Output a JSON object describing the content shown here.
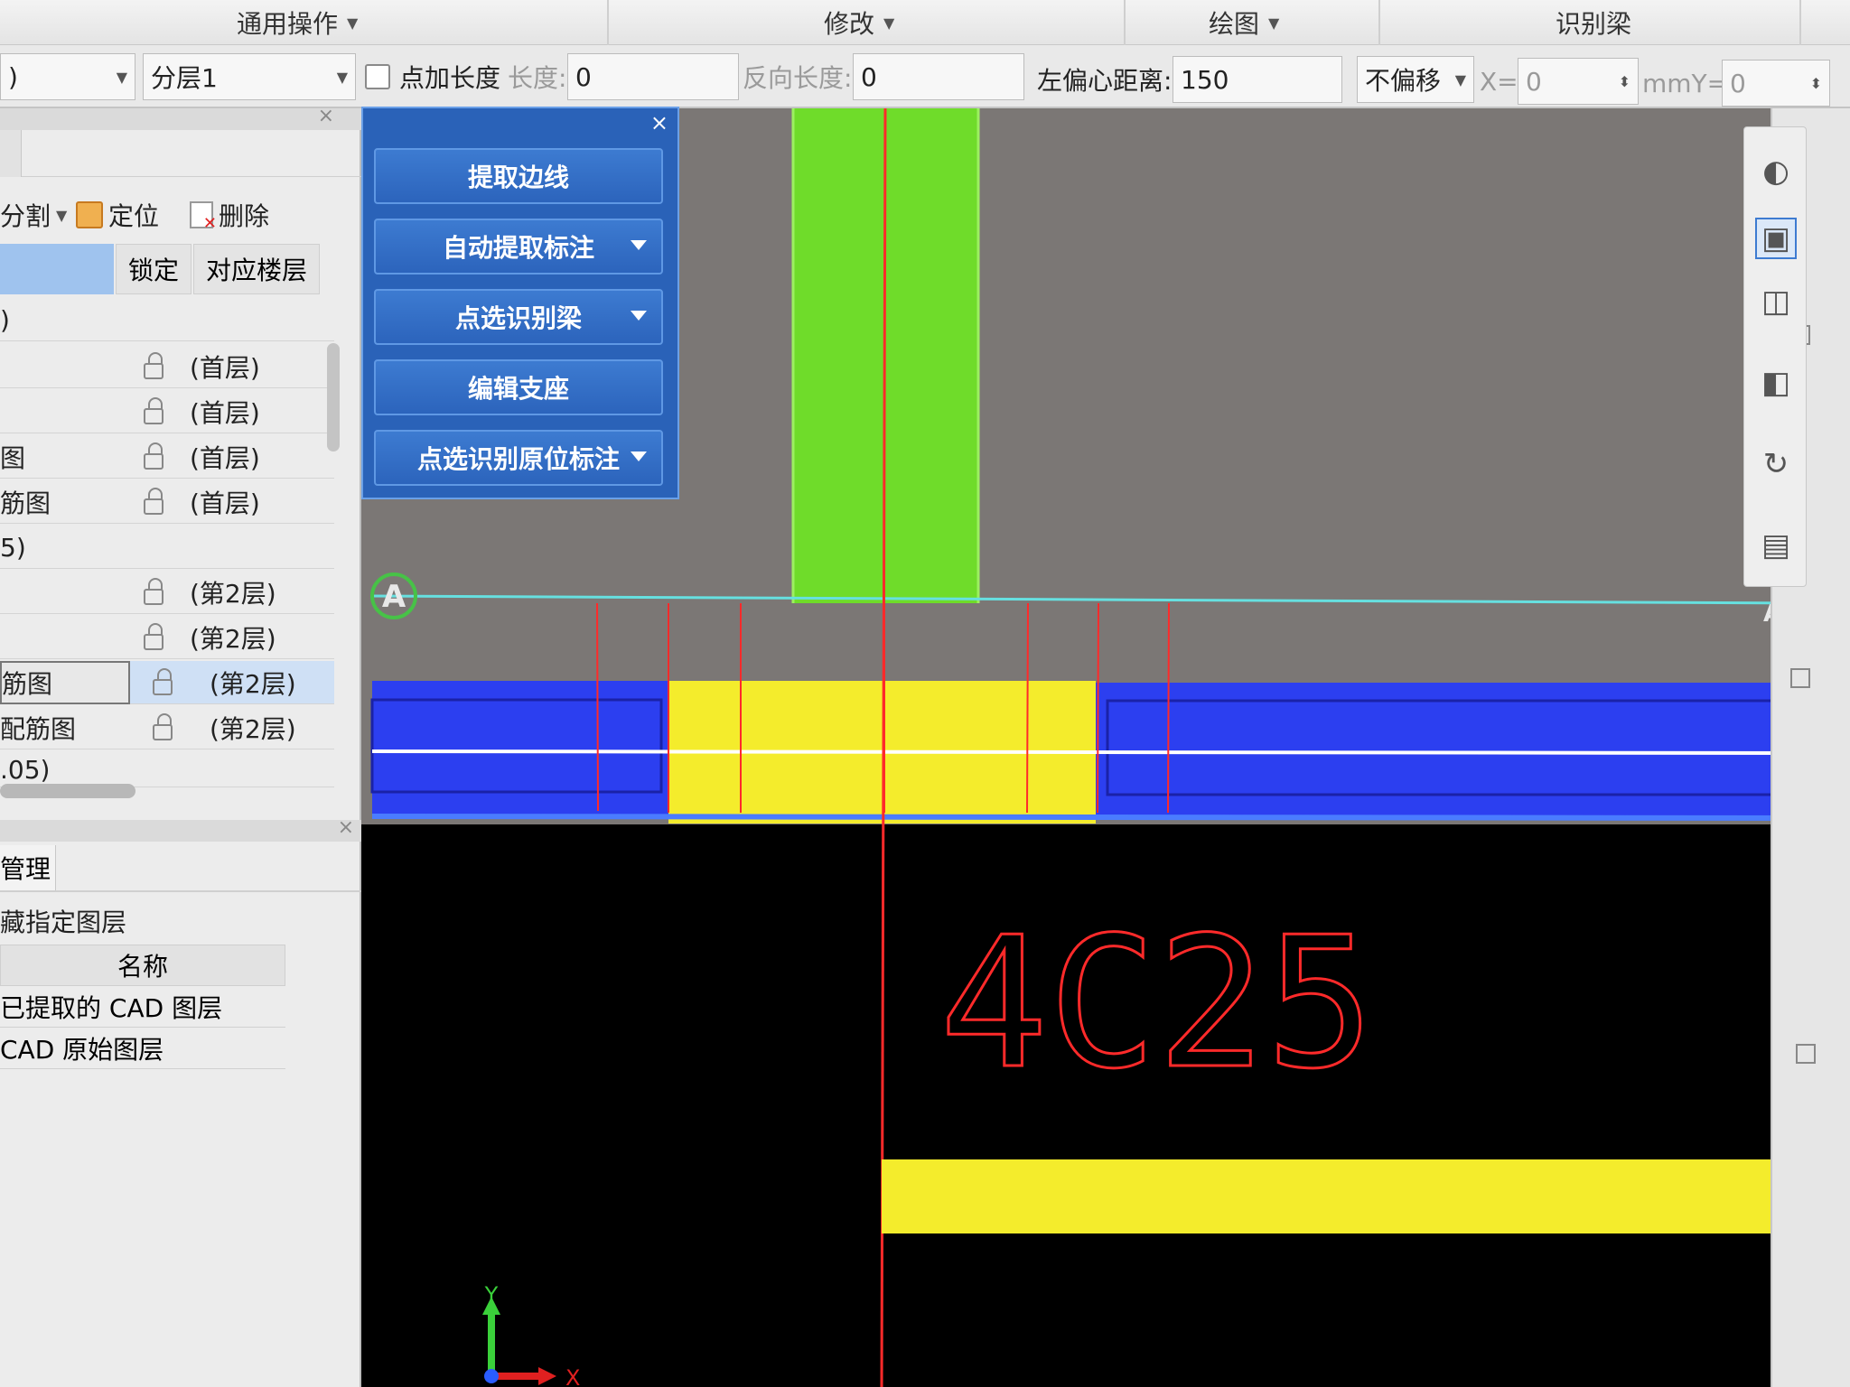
{
  "ribbon": {
    "groups": [
      {
        "label": "通用操作"
      },
      {
        "label": "修改"
      },
      {
        "label": "绘图"
      },
      {
        "label": "识别梁"
      }
    ]
  },
  "optbar": {
    "first_select_value": ")",
    "layer_select_value": "分层1",
    "add_length_label": "点加长度",
    "length_label": "长度:",
    "length_value": "0",
    "reverse_length_label": "反向长度:",
    "reverse_length_value": "0",
    "left_offset_label": "左偏心距离:",
    "left_offset_value": "150",
    "offset_mode_value": "不偏移",
    "x_label": "X=",
    "x_value": "0",
    "mmy_label": "mmY=",
    "y_value": "0"
  },
  "leftpanel": {
    "toolbar": {
      "split_label": "分割",
      "locate_label": "定位",
      "delete_label": "删除"
    },
    "table_headers": [
      "锁定",
      "对应楼层"
    ],
    "rows": [
      {
        "name": ")",
        "floor": ""
      },
      {
        "name": "",
        "floor": "(首层)"
      },
      {
        "name": "",
        "floor": "(首层)"
      },
      {
        "name": "图",
        "floor": "(首层)"
      },
      {
        "name": "筋图",
        "floor": "(首层)"
      },
      {
        "name": "5)",
        "floor": ""
      },
      {
        "name": "",
        "floor": "(第2层)"
      },
      {
        "name": "",
        "floor": "(第2层)"
      },
      {
        "name": "筋图",
        "floor": "(第2层)"
      },
      {
        "name": "配筋图",
        "floor": "(第2层)"
      },
      {
        "name": ".05)",
        "floor": ""
      }
    ],
    "layer_manager": {
      "title": "管理",
      "hide_label": "藏指定图层",
      "name_header": "名称",
      "items": [
        "已提取的 CAD 图层",
        "CAD 原始图层"
      ]
    }
  },
  "bluepanel": {
    "close_label": "×",
    "buttons": [
      {
        "label": "提取边线",
        "dropdown": false
      },
      {
        "label": "自动提取标注",
        "dropdown": true
      },
      {
        "label": "点选识别梁",
        "dropdown": true
      },
      {
        "label": "编辑支座",
        "dropdown": false
      },
      {
        "label": "点选识别原位标注",
        "dropdown": true
      }
    ]
  },
  "canvas": {
    "axis_label": "A",
    "axis_label_right": "A",
    "rebar_text": "4C25",
    "ucs_y": "Y",
    "ucs_x": "X"
  },
  "colors": {
    "canvas_bg": "#000000",
    "cad_gray": "#7b7775",
    "column_green": "#6fdc2a",
    "beam_blue": "#2c3ff0",
    "support_yellow": "#f4ec2c",
    "red_line": "#ff2a2a",
    "axis_cyan": "#66e0e0",
    "panel_blue": "#2a62b8"
  }
}
